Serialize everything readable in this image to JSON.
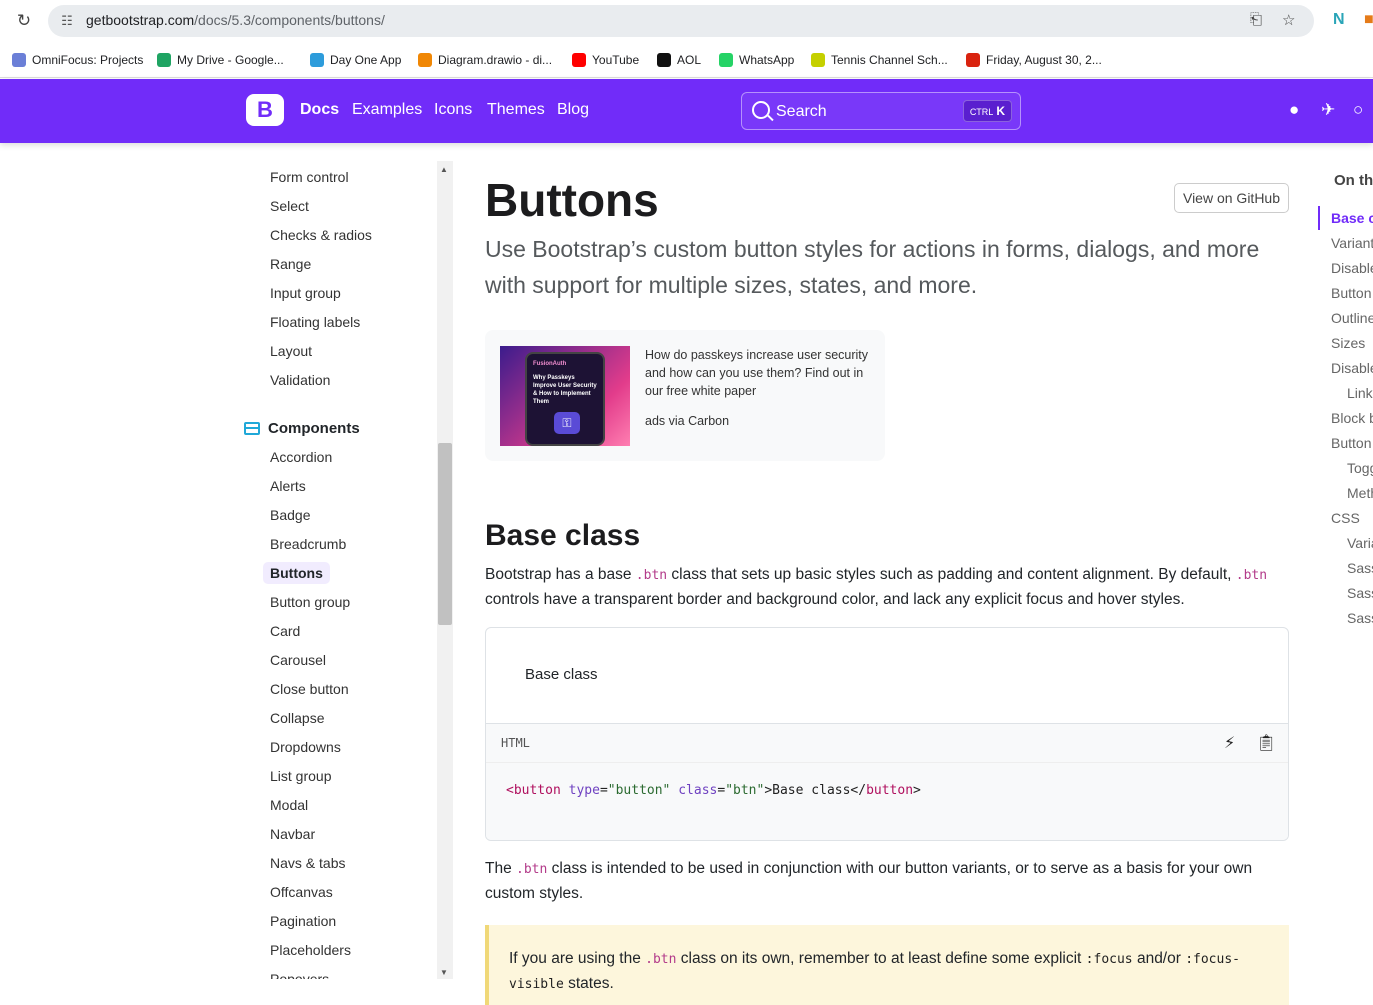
{
  "browser": {
    "url_host": "getbootstrap.com",
    "url_path": "/docs/5.3/components/buttons/",
    "bookmarks": [
      {
        "label": "OmniFocus: Projects",
        "icon": "omnifocus-icon",
        "color": "#6b7fd7"
      },
      {
        "label": "My Drive - Google...",
        "icon": "google-drive-icon",
        "color": "#1fa463"
      },
      {
        "label": "Day One App",
        "icon": "day-one-icon",
        "color": "#2d9cdb"
      },
      {
        "label": "Diagram.drawio - di...",
        "icon": "drawio-icon",
        "color": "#f08705"
      },
      {
        "label": "YouTube",
        "icon": "youtube-icon",
        "color": "#ff0000"
      },
      {
        "label": "AOL",
        "icon": "aol-icon",
        "color": "#111111"
      },
      {
        "label": "WhatsApp",
        "icon": "whatsapp-icon",
        "color": "#25d366"
      },
      {
        "label": "Tennis Channel Sch...",
        "icon": "tennis-channel-icon",
        "color": "#c5d000"
      },
      {
        "label": "Friday, August 30, 2...",
        "icon": "calendar-icon",
        "color": "#d9230f"
      }
    ]
  },
  "navbar": {
    "logo": "B",
    "links": [
      "Docs",
      "Examples",
      "Icons",
      "Themes",
      "Blog"
    ],
    "search_placeholder": "Search",
    "kbd_ctrl": "CTRL",
    "kbd_key": "K",
    "brand_color": "#712cf9"
  },
  "sidebar": {
    "forms_items": [
      "Form control",
      "Select",
      "Checks & radios",
      "Range",
      "Input group",
      "Floating labels",
      "Layout",
      "Validation"
    ],
    "components_heading": "Components",
    "component_items": [
      "Accordion",
      "Alerts",
      "Badge",
      "Breadcrumb",
      "Buttons",
      "Button group",
      "Card",
      "Carousel",
      "Close button",
      "Collapse",
      "Dropdowns",
      "List group",
      "Modal",
      "Navbar",
      "Navs & tabs",
      "Offcanvas",
      "Pagination",
      "Placeholders",
      "Popovers"
    ],
    "active_item": "Buttons"
  },
  "main": {
    "title": "Buttons",
    "github_button": "View on GitHub",
    "lead": "Use Bootstrap’s custom button styles for actions in forms, dialogs, and more with support for multiple sizes, states, and more.",
    "ad": {
      "image_brand": "FusionAuth",
      "image_text": "Why Passkeys Improve User Security & How to Implement Them",
      "text": "How do passkeys increase user security and how can you use them? Find out in our free white paper",
      "via": "ads via Carbon"
    },
    "section_title": "Base class",
    "p1_a": "Bootstrap has a base ",
    "p1_code1": ".btn",
    "p1_b": " class that sets up basic styles such as padding and content alignment. By default, ",
    "p1_code2": ".btn",
    "p1_c": " controls have a transparent border and background color, and lack any explicit focus and hover styles.",
    "example_button": "Base class",
    "code_lang": "HTML",
    "code": {
      "open_lt": "<",
      "tag": "button",
      "attr1": "type",
      "val1": "\"button\"",
      "attr2": "class",
      "val2": "\"btn\"",
      "text": ">Base class</",
      "close_tag": "button",
      "gt": ">"
    },
    "p2_a": "The ",
    "p2_code": ".btn",
    "p2_b": " class is intended to be used in conjunction with our button variants, or to serve as a basis for your own custom styles.",
    "callout_a": "If you are using the ",
    "callout_code1": ".btn",
    "callout_b": " class on its own, remember to at least define some explicit ",
    "callout_code2": ":focus",
    "callout_c": " and/or ",
    "callout_code3": ":focus-visible",
    "callout_d": " states."
  },
  "toc": {
    "title": "On this page",
    "items": [
      {
        "label": "Base class",
        "sub": false,
        "active": true
      },
      {
        "label": "Variants",
        "sub": false
      },
      {
        "label": "Disable text wrapping",
        "sub": false
      },
      {
        "label": "Button tags",
        "sub": false
      },
      {
        "label": "Outline buttons",
        "sub": false
      },
      {
        "label": "Sizes",
        "sub": false
      },
      {
        "label": "Disabled state",
        "sub": false
      },
      {
        "label": "Link functionality caveat",
        "sub": true
      },
      {
        "label": "Block buttons",
        "sub": false
      },
      {
        "label": "Button plugin",
        "sub": false
      },
      {
        "label": "Toggle states",
        "sub": true
      },
      {
        "label": "Methods",
        "sub": true
      },
      {
        "label": "CSS",
        "sub": false
      },
      {
        "label": "Variables",
        "sub": true
      },
      {
        "label": "Sass mixins",
        "sub": true
      },
      {
        "label": "Sass loops",
        "sub": true
      },
      {
        "label": "Sass maps",
        "sub": true
      }
    ]
  }
}
